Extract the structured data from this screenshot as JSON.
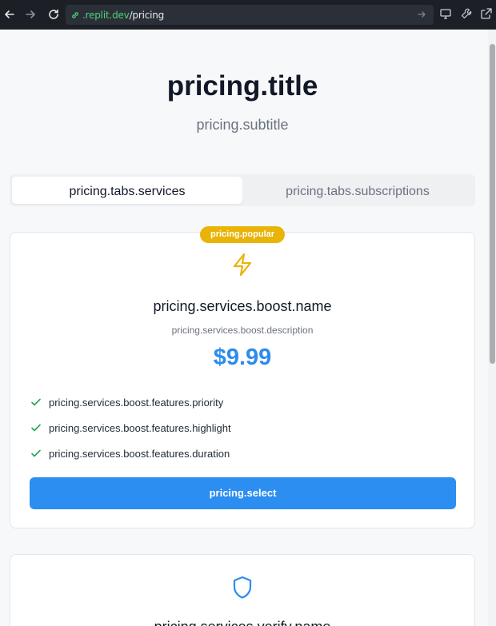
{
  "browser": {
    "url_domain": ".replit.dev",
    "url_path": "/pricing"
  },
  "pricing": {
    "title": "pricing.title",
    "subtitle": "pricing.subtitle",
    "tabs": [
      {
        "label": "pricing.tabs.services",
        "active": true
      },
      {
        "label": "pricing.tabs.subscriptions",
        "active": false
      }
    ],
    "popular_badge": "pricing.popular",
    "select_label": "pricing.select",
    "cards": [
      {
        "icon": "lightning-icon",
        "name": "pricing.services.boost.name",
        "description": "pricing.services.boost.description",
        "price": "$9.99",
        "features": [
          "pricing.services.boost.features.priority",
          "pricing.services.boost.features.highlight",
          "pricing.services.boost.features.duration"
        ]
      },
      {
        "icon": "shield-icon",
        "name": "pricing.services.verify.name"
      }
    ]
  },
  "colors": {
    "accent": "#2b8ef0",
    "price": "#2d8ceb",
    "badge": "#eab308",
    "check": "#22a35a"
  }
}
